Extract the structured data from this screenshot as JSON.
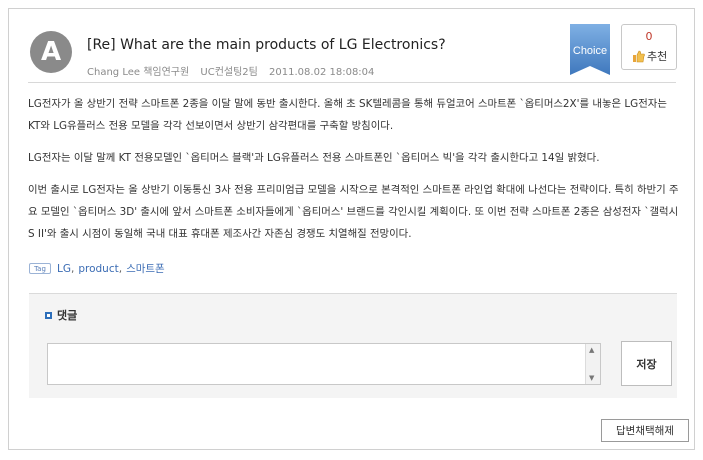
{
  "post": {
    "avatar_letter": "A",
    "title": "[Re] What are the main products of LG Electronics?",
    "author": "Chang Lee 책임연구원",
    "team": "UC컨설팅2팀",
    "datetime": "2011.08.02 18:08:04",
    "choice_badge": "Choice",
    "recommend_count": "0",
    "recommend_label": "추천",
    "paragraphs": [
      "LG전자가 올 상반기 전략 스마트폰 2종을 이달 말에 동반 출시한다. 올해 초 SK텔레콤을 통해 듀얼코어 스마트폰 `옵티머스2X'를 내놓은 LG전자는 KT와 LG유플러스 전용 모델을 각각 선보이면서 상반기 삼각편대를 구축할 방침이다.",
      "LG전자는 이달 말께 KT 전용모델인 `옵티머스 블랙'과 LG유플러스 전용 스마트폰인 `옵티머스 빅'을 각각 출시한다고 14일 밝혔다.",
      "이번 출시로 LG전자는 올 상반기 이동통신 3사 전용 프리미엄급 모델을 시작으로 본격적인 스마트폰 라인업 확대에 나선다는 전략이다. 특히 하반기 주요 모델인 `옵티머스 3D' 출시에 앞서 스마트폰 소비자들에게 `옵티머스' 브랜드를 각인시킬 계획이다. 또 이번 전략 스마트폰 2종은 삼성전자 `갤럭시S II'와 출시 시점이 동일해 국내 대표 휴대폰 제조사간 자존심 경쟁도 치열해질 전망이다."
    ],
    "tag_icon": "Tag",
    "tags": [
      "LG",
      "product",
      "스마트폰"
    ]
  },
  "comment": {
    "label": "댓글",
    "input_value": "",
    "save_label": "저장"
  },
  "footer": {
    "cancel_choice_label": "답변채택해제"
  },
  "colors": {
    "choice_blue": "#4f86c6",
    "link_blue": "#3b6cb4",
    "count_red": "#c0392b"
  }
}
